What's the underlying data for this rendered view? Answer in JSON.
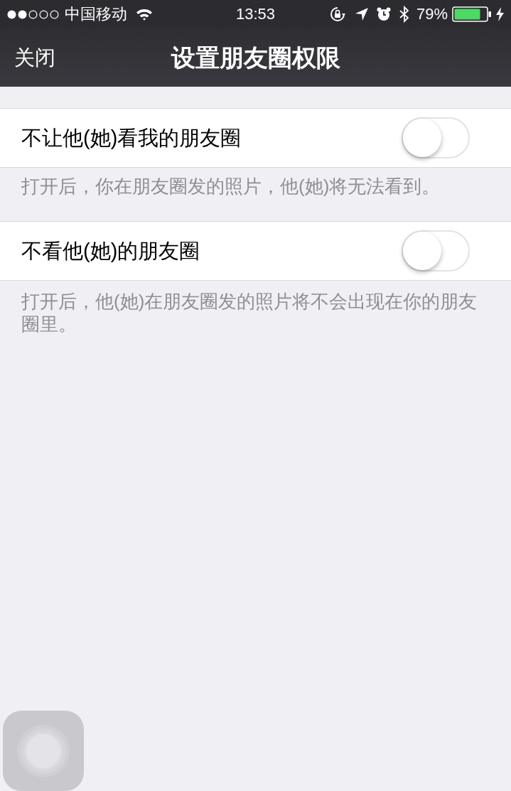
{
  "status_bar": {
    "carrier": "中国移动",
    "time": "13:53",
    "battery": "79%"
  },
  "nav_bar": {
    "close": "关闭",
    "title": "设置朋友圈权限"
  },
  "settings": [
    {
      "label": "不让他(她)看我的朋友圈",
      "on": false,
      "footer": "打开后，你在朋友圈发的照片，他(她)将无法看到。"
    },
    {
      "label": "不看他(她)的朋友圈",
      "on": false,
      "footer": "打开后，他(她)在朋友圈发的照片将不会出现在你的朋友圈里。"
    }
  ]
}
